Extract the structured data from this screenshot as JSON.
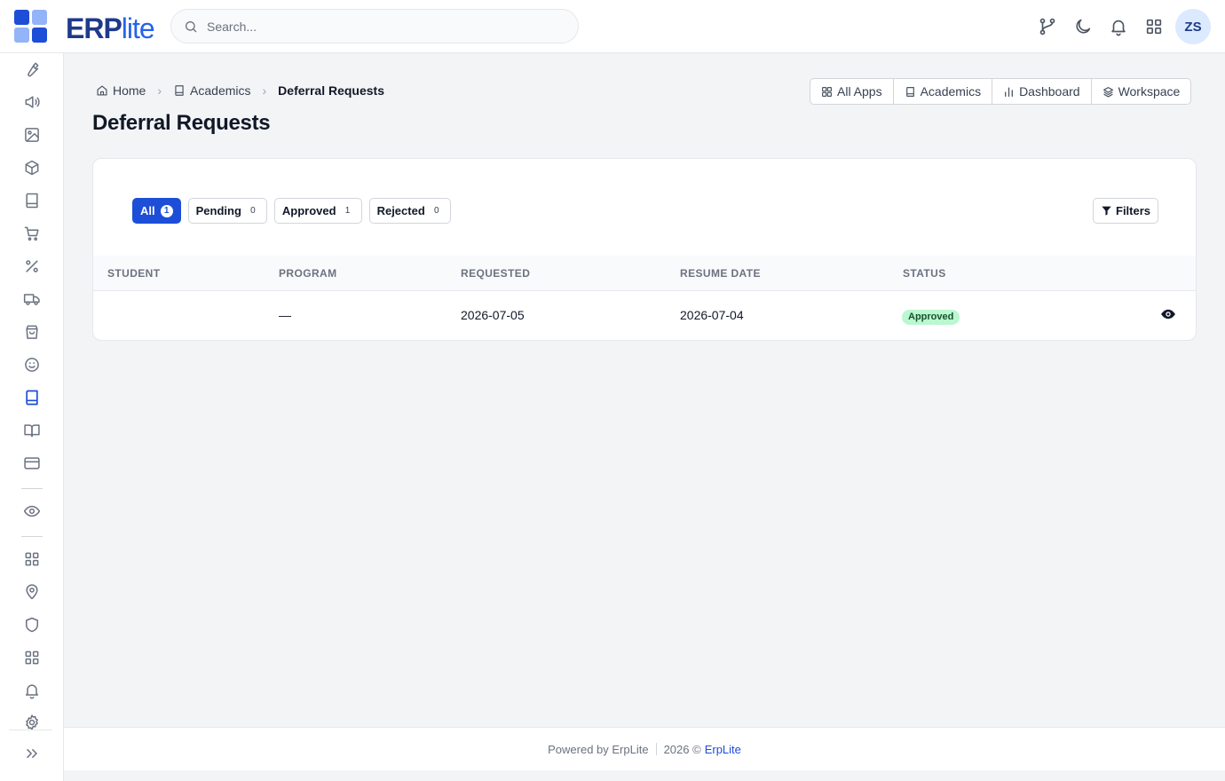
{
  "app": {
    "brand_strong": "ERP",
    "brand_light": "lite"
  },
  "search": {
    "placeholder": "Search..."
  },
  "header": {
    "avatar_initials": "ZS"
  },
  "breadcrumb": {
    "home": "Home",
    "section": "Academics",
    "current": "Deferral Requests"
  },
  "page": {
    "title": "Deferral Requests"
  },
  "quicklinks": [
    {
      "label": "All Apps",
      "icon": "grid-icon"
    },
    {
      "label": "Academics",
      "icon": "book-icon"
    },
    {
      "label": "Dashboard",
      "icon": "bar-chart-icon"
    },
    {
      "label": "Workspace",
      "icon": "layers-icon"
    }
  ],
  "tabs": [
    {
      "label": "All",
      "count": "1",
      "active": true
    },
    {
      "label": "Pending",
      "count": "0"
    },
    {
      "label": "Approved",
      "count": "1"
    },
    {
      "label": "Rejected",
      "count": "0"
    }
  ],
  "filters": {
    "label": "Filters"
  },
  "table": {
    "columns": [
      "STUDENT",
      "PROGRAM",
      "REQUESTED",
      "RESUME DATE",
      "STATUS"
    ],
    "rows": [
      {
        "student": "",
        "program": "—",
        "requested": "2026-07-05",
        "resume_date": "2026-07-04",
        "status": "Approved"
      }
    ]
  },
  "footer": {
    "powered": "Powered by ErpLite",
    "copyright": "2026 ©",
    "link": "ErpLite"
  },
  "sidebar": {
    "icons": [
      "wrench-icon",
      "megaphone-icon",
      "image-icon",
      "cube-icon",
      "book-icon",
      "cart-icon",
      "percent-icon",
      "truck-icon",
      "shopping-bag-icon",
      "smile-icon",
      "book-active-icon",
      "open-book-icon",
      "credit-card-icon",
      "eye-icon",
      "grid-icon",
      "map-pin-icon",
      "shield-icon",
      "grid-icon",
      "bell-icon",
      "settings-icon",
      "expand-icon"
    ]
  },
  "colors": {
    "primary": "#1d4ed8",
    "brand_dark": "#1e3a8a",
    "approved_bg": "#bbf7d0",
    "approved_text": "#14532d"
  }
}
